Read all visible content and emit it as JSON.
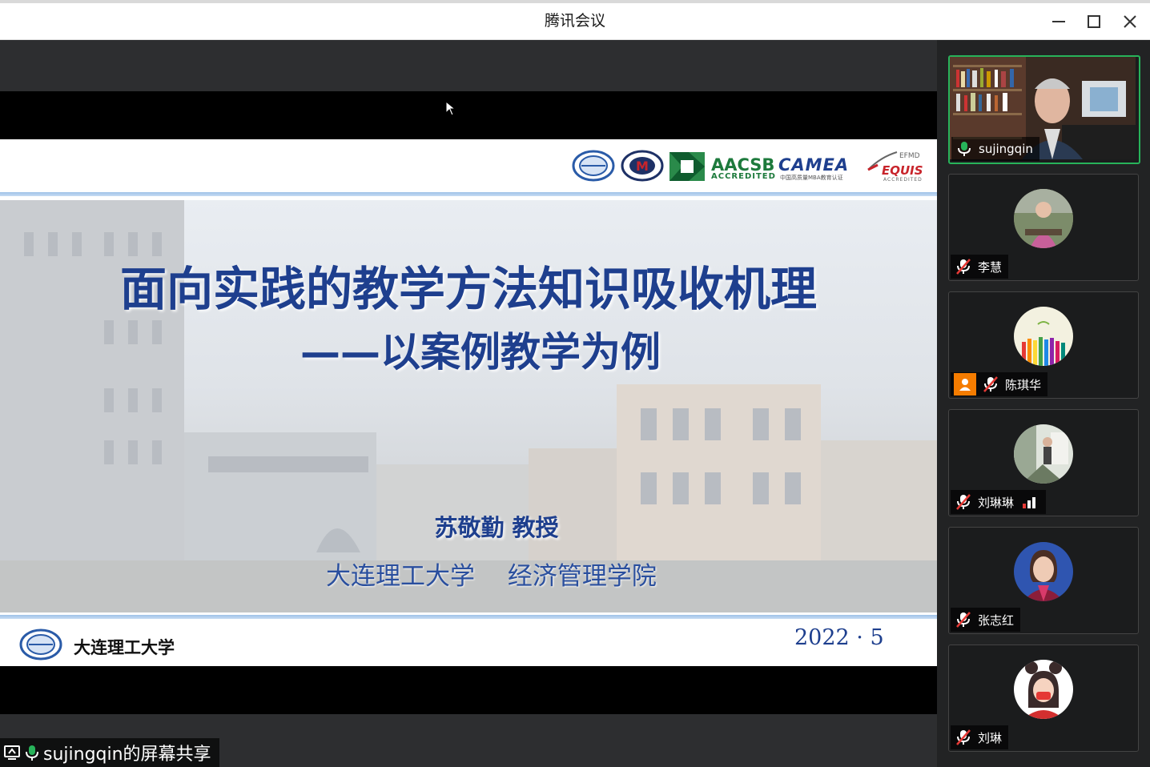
{
  "window": {
    "title": "腾讯会议"
  },
  "slide": {
    "title_line1": "面向实践的教学方法知识吸收机理",
    "title_line2": "——以案例教学为例",
    "presenter": "苏敬勤 教授",
    "affiliation": "大连理工大学　 经济管理学院",
    "date": "2022 · 5",
    "footer_org": "大连理工大学",
    "logos": {
      "aacsb": "AACSB",
      "aacsb_sub": "ACCREDITED",
      "camea": "CAMEA",
      "camea_sub": "中国高质量MBA教育认证",
      "efmd": "EFMD",
      "equis": "EQUIS",
      "equis_sub": "ACCREDITED"
    }
  },
  "participants": [
    {
      "name": "sujingqin",
      "mic": "on",
      "video": true
    },
    {
      "name": "李慧",
      "mic": "muted"
    },
    {
      "name": "陈琪华",
      "mic": "muted",
      "host_badge": true
    },
    {
      "name": "刘琳琳",
      "mic": "muted",
      "signal": true
    },
    {
      "name": "张志红",
      "mic": "muted"
    },
    {
      "name": "刘琳",
      "mic": "muted"
    }
  ],
  "screen_share": {
    "label": "sujingqin的屏幕共享"
  },
  "colors": {
    "title_blue": "#1e3f8e",
    "active_border": "#27b35a",
    "mic_on": "#27b35a"
  }
}
